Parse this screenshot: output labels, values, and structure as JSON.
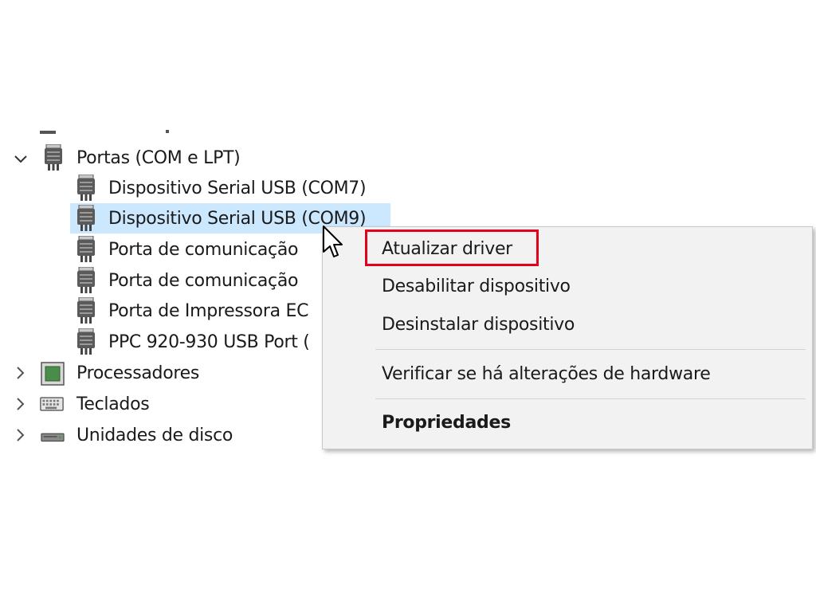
{
  "tree": {
    "ports": {
      "label": "Portas (COM e LPT)",
      "expanded": true,
      "children": [
        "Dispositivo Serial USB (COM7)",
        "Dispositivo Serial USB (COM9)",
        "Porta de comunicação",
        "Porta de comunicação",
        "Porta de Impressora EC",
        "PPC 920-930 USB Port ("
      ],
      "selected_index": 1
    },
    "processors": {
      "label": "Processadores"
    },
    "keyboards": {
      "label": "Teclados"
    },
    "disks": {
      "label": "Unidades de disco"
    }
  },
  "context_menu": {
    "update_driver": "Atualizar driver",
    "disable_device": "Desabilitar dispositivo",
    "uninstall_device": "Desinstalar dispositivo",
    "scan_hardware": "Verificar se há alterações de hardware",
    "properties": "Propriedades"
  },
  "colors": {
    "selection": "#cce8ff",
    "highlight_box": "#e2001a",
    "menu_background": "#f2f2f2"
  }
}
